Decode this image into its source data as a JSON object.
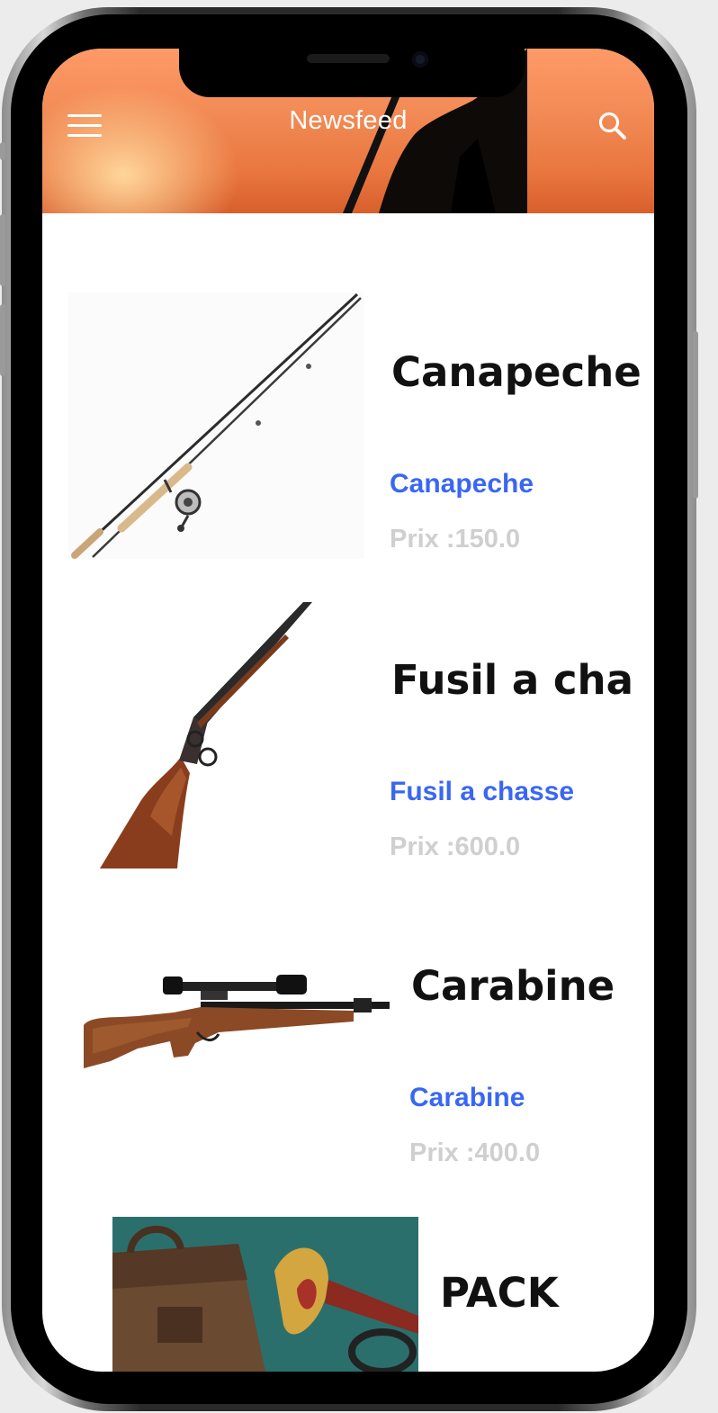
{
  "header": {
    "title": "Newsfeed",
    "menu_icon": "hamburger-menu-icon",
    "search_icon": "search-icon"
  },
  "products": [
    {
      "name": "Canapeche",
      "subtitle": "Canapeche",
      "price": "Prix :150.0",
      "image": "fishing-rod"
    },
    {
      "name": "Fusil a cha",
      "subtitle": "Fusil a chasse",
      "price": "Prix :600.0",
      "image": "shotgun"
    },
    {
      "name": "Carabine",
      "subtitle": "Carabine",
      "price": "Prix :400.0",
      "image": "scoped-rifle"
    },
    {
      "name": "PACK",
      "subtitle": "",
      "price": "",
      "image": "leather-bag-and-horn"
    }
  ],
  "colors": {
    "subtitle": "#3a67f2",
    "price": "#cfcfcf",
    "header_sunset": "#f28a55"
  }
}
